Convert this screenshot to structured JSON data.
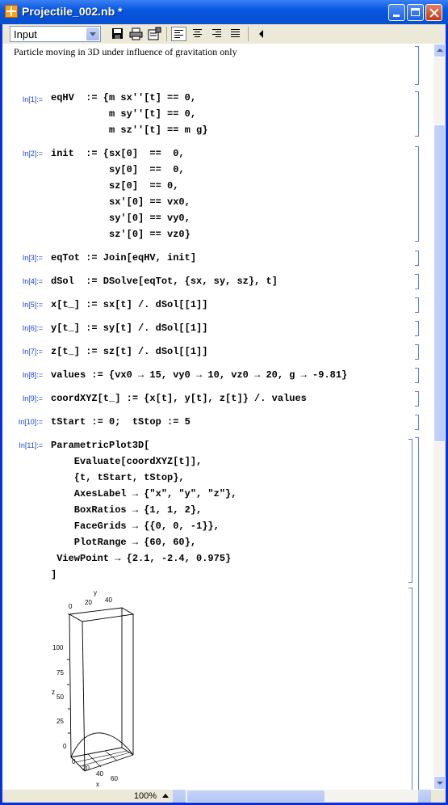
{
  "window": {
    "title": "Projectile_002.nb *"
  },
  "toolbar": {
    "style_value": "Input"
  },
  "notebook": {
    "text_cell": "Particle moving in 3D under influence of gravitation only",
    "cells": [
      {
        "label": "In[1]:=",
        "code": "eqHV  := {m sx''[t] == 0,\n          m sy''[t] == 0,\n          m sz''[t] == m g}"
      },
      {
        "label": "In[2]:=",
        "code": "init  := {sx[0]  ==  0,\n          sy[0]  ==  0,\n          sz[0]  == 0,\n          sx'[0] == vx0,\n          sy'[0] == vy0,\n          sz'[0] == vz0}"
      },
      {
        "label": "In[3]:=",
        "code": "eqTot := Join[eqHV, init]"
      },
      {
        "label": "In[4]:=",
        "code": "dSol  := DSolve[eqTot, {sx, sy, sz}, t]"
      },
      {
        "label": "In[5]:=",
        "code": "x[t_] := sx[t] /. dSol[[1]]"
      },
      {
        "label": "In[6]:=",
        "code": "y[t_] := sy[t] /. dSol[[1]]"
      },
      {
        "label": "In[7]:=",
        "code": "z[t_] := sz[t] /. dSol[[1]]"
      },
      {
        "label": "In[8]:=",
        "code": "values := {vx0 → 15, vy0 → 10, vz0 → 20, g → -9.81}"
      },
      {
        "label": "In[9]:=",
        "code": "coordXYZ[t_] := {x[t], y[t], z[t]} /. values"
      },
      {
        "label": "In[10]:=",
        "code": "tStart := 0;  tStop := 5"
      },
      {
        "label": "In[11]:=",
        "code": "ParametricPlot3D[\n    Evaluate[coordXYZ[t]],\n    {t, tStart, tStop},\n    AxesLabel → {\"x\", \"y\", \"z\"},\n    BoxRatios → {1, 1, 2},\n    FaceGrids → {{0, 0, -1}},\n    PlotRange → {60, 60},\n ViewPoint → {2.1, -2.4, 0.975}\n]"
      }
    ],
    "plot": {
      "y_axis_label": "y",
      "y_ticks": [
        "0",
        "20",
        "40"
      ],
      "z_axis_label": "z",
      "z_ticks": [
        "100",
        "75",
        "50",
        "25",
        "0"
      ],
      "x_ticks": [
        "0",
        "20",
        "40",
        "60"
      ],
      "x_axis_label": "x"
    }
  },
  "status": {
    "zoom": "100%"
  },
  "colors": {
    "title_bar": "#0a58e0",
    "cell_label": "#1a44c4",
    "bracket": "#5b7de1"
  }
}
